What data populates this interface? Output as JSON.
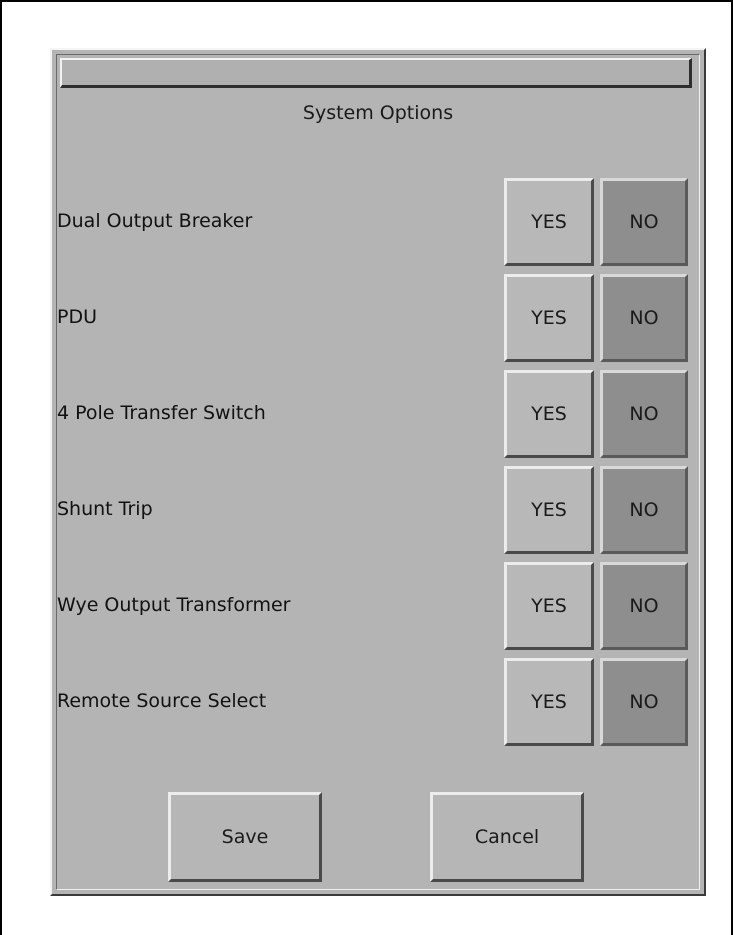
{
  "dialog": {
    "title": "System Options"
  },
  "options": [
    {
      "label": "Dual Output Breaker",
      "yes_label": "YES",
      "no_label": "NO",
      "selected": "NO"
    },
    {
      "label": "PDU",
      "yes_label": "YES",
      "no_label": "NO",
      "selected": "NO"
    },
    {
      "label": "4 Pole Transfer Switch",
      "yes_label": "YES",
      "no_label": "NO",
      "selected": "NO"
    },
    {
      "label": "Shunt Trip",
      "yes_label": "YES",
      "no_label": "NO",
      "selected": "NO"
    },
    {
      "label": "Wye Output Transformer",
      "yes_label": "YES",
      "no_label": "NO",
      "selected": "NO"
    },
    {
      "label": "Remote Source Select",
      "yes_label": "YES",
      "no_label": "NO",
      "selected": "NO"
    }
  ],
  "footer": {
    "save_label": "Save",
    "cancel_label": "Cancel"
  },
  "colors": {
    "window_bg": "#b4b4b4",
    "yes_bg": "#b8b8b8",
    "no_selected_bg": "#8e8e8e"
  }
}
